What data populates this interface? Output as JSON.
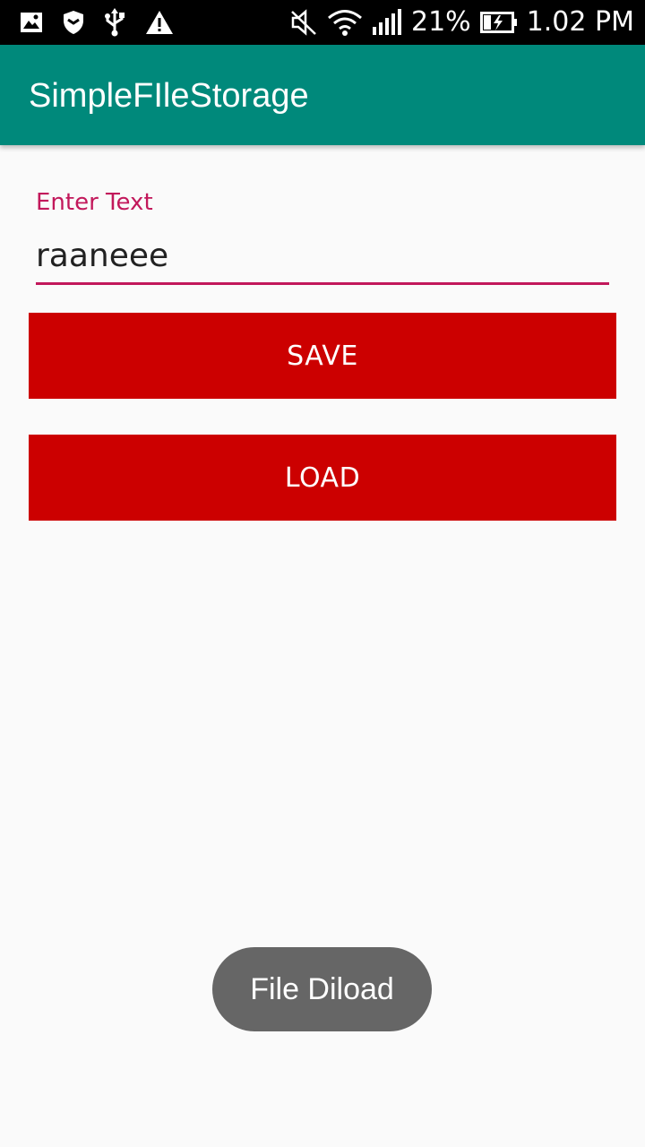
{
  "status_bar": {
    "battery_percent": "21%",
    "time": "1.02 PM",
    "icons": [
      "gallery-icon",
      "shield-icon",
      "usb-icon",
      "warning-icon",
      "mute-icon",
      "wifi-icon",
      "signal-icon",
      "battery-charging-icon"
    ]
  },
  "app_bar": {
    "title": "SimpleFIleStorage",
    "color": "#00897b"
  },
  "form": {
    "label": "Enter Text",
    "value": "raaneee",
    "accent_color": "#c2185b"
  },
  "buttons": {
    "save_label": "SAVE",
    "load_label": "LOAD",
    "color": "#cc0000"
  },
  "toast": {
    "message": "File Diload"
  }
}
